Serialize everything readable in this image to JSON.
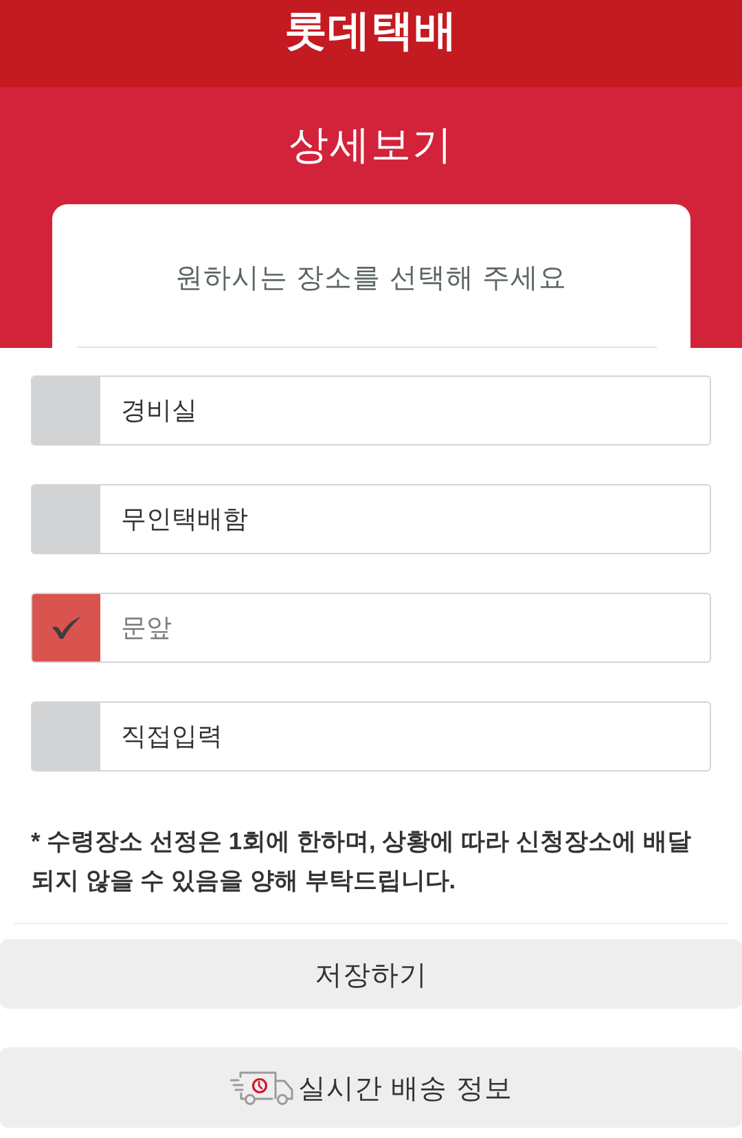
{
  "header": {
    "logo": "롯데택배"
  },
  "page_title": "상세보기",
  "card": {
    "prompt": "원하시는 장소를 선택해 주세요"
  },
  "options": [
    {
      "label": "경비실",
      "checked": false
    },
    {
      "label": "무인택배함",
      "checked": false
    },
    {
      "label": "문앞",
      "checked": true
    },
    {
      "label": "직접입력",
      "checked": false
    }
  ],
  "notice": "* 수령장소 선정은 1회에 한하며, 상황에 따라 신청장소에 배달되지 않을 수 있음을 양해 부탁드립니다.",
  "buttons": [
    {
      "kind": "save",
      "label": "저장하기"
    },
    {
      "kind": "tracking",
      "label": "실시간 배송 정보"
    }
  ]
}
